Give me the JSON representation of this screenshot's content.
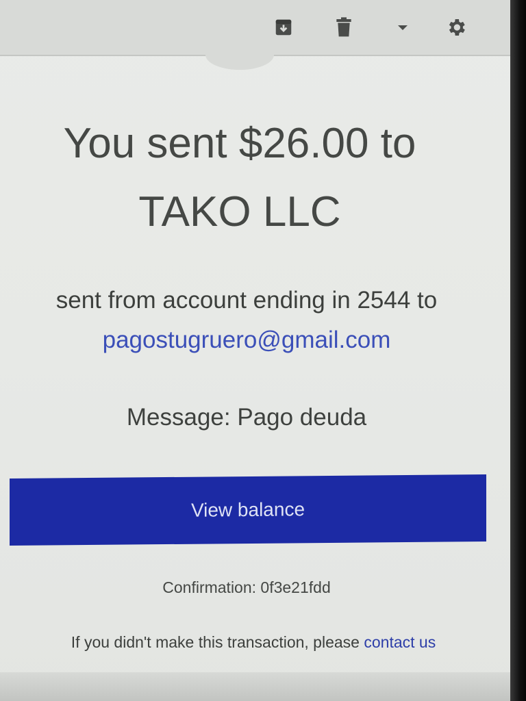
{
  "toolbar": {
    "icons": [
      "archive-icon",
      "trash-icon",
      "dropdown-caret-icon",
      "settings-gear-icon"
    ]
  },
  "email": {
    "headline_line1": "You sent $26.00 to",
    "headline_line2": "TAKO LLC",
    "sent_from_text": "sent from account ending in 2544 to",
    "recipient_email": "pagostugruero@gmail.com",
    "message_label": "Message:",
    "message_text": "Pago deuda",
    "view_balance_label": "View balance",
    "confirmation_label": "Confirmation:",
    "confirmation_code": "0f3e21fdd",
    "footer_text": "If you didn't make this transaction, please",
    "footer_link": "contact us"
  },
  "colors": {
    "button_bg": "#1c2aa4",
    "link": "#3b4fb8",
    "text": "#454845",
    "background": "#e9ebe8"
  }
}
